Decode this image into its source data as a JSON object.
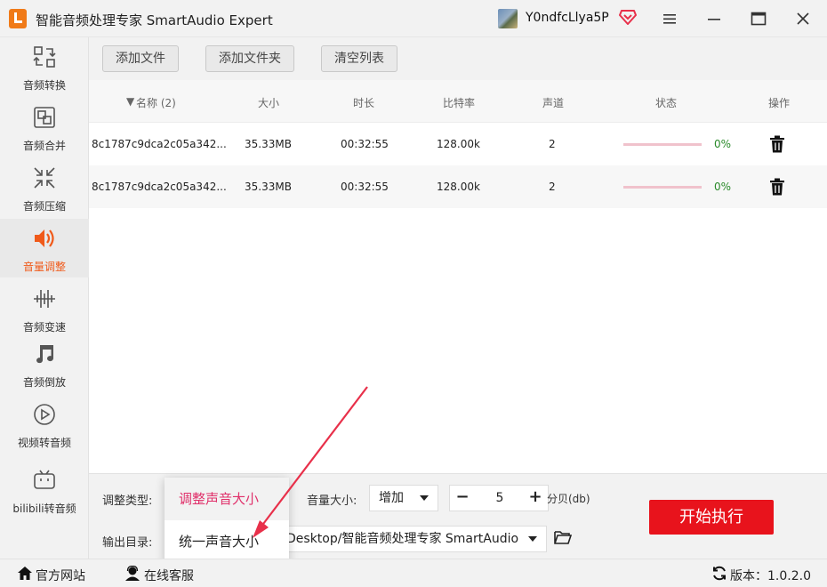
{
  "app": {
    "title": "智能音频处理专家 SmartAudio Expert",
    "user_name": "Y0ndfcLlya5P"
  },
  "sidebar": {
    "items": [
      {
        "label": "音频转换",
        "icon": "convert-icon",
        "active": false
      },
      {
        "label": "音频合并",
        "icon": "merge-icon",
        "active": false
      },
      {
        "label": "音频压缩",
        "icon": "compress-icon",
        "active": false
      },
      {
        "label": "音量调整",
        "icon": "volume-icon",
        "active": true
      },
      {
        "label": "音频变速",
        "icon": "waveform-icon",
        "active": false
      },
      {
        "label": "音频倒放",
        "icon": "music-note-icon",
        "active": false
      },
      {
        "label": "视频转音频",
        "icon": "play-circle-icon",
        "active": false
      },
      {
        "label": "bilibili转音频",
        "icon": "bilibili-icon",
        "active": false
      }
    ]
  },
  "toolbar": {
    "add_file": "添加文件",
    "add_folder": "添加文件夹",
    "clear_list": "清空列表"
  },
  "table": {
    "columns": [
      "名称 (2)",
      "大小",
      "时长",
      "比特率",
      "声道",
      "状态",
      "操作"
    ],
    "rows": [
      {
        "name": "8c1787c9dca2c05a342...",
        "size": "35.33MB",
        "duration": "00:32:55",
        "bitrate": "128.00k",
        "channels": "2",
        "progress": 0,
        "progress_text": "0%"
      },
      {
        "name": "8c1787c9dca2c05a342...",
        "size": "35.33MB",
        "duration": "00:32:55",
        "bitrate": "128.00k",
        "channels": "2",
        "progress": 0,
        "progress_text": "0%"
      }
    ]
  },
  "settings": {
    "adjust_type_label": "调整类型:",
    "volume_label": "音量大小:",
    "volume_direction": "增加",
    "volume_value": "5",
    "volume_unit": "分贝(db)",
    "output_label": "输出目录:",
    "output_path": "Desktop/智能音频处理专家 SmartAudio",
    "start_button": "开始执行"
  },
  "adjust_type_menu": {
    "options": [
      "调整声音大小",
      "统一声音大小"
    ],
    "selected_index": 0
  },
  "footer": {
    "website": "官方网站",
    "support": "在线客服",
    "version": "版本：1.0.2.0"
  },
  "colors": {
    "accent": "#f05a1a",
    "start_button": "#e8131c",
    "selected_menu_text": "#e0306a",
    "progress_track": "#f0c2cc",
    "percent_text": "#2a8a2a",
    "annotation_arrow": "#e8304a"
  }
}
